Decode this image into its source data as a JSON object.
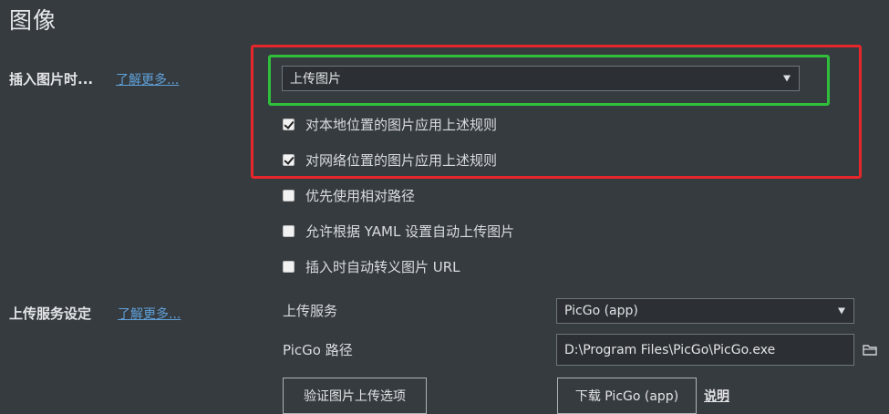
{
  "section": {
    "title": "图像"
  },
  "insert_image": {
    "label": "插入图片时...",
    "learn_more": "了解更多...",
    "action_select": {
      "value": "上传图片"
    },
    "options": [
      {
        "label": "对本地位置的图片应用上述规则",
        "checked": true
      },
      {
        "label": "对网络位置的图片应用上述规则",
        "checked": true
      },
      {
        "label": "优先使用相对路径",
        "checked": false
      },
      {
        "label": "允许根据 YAML 设置自动上传图片",
        "checked": false
      },
      {
        "label": "插入时自动转义图片 URL",
        "checked": false
      }
    ]
  },
  "upload_service": {
    "label": "上传服务设定",
    "learn_more": "了解更多...",
    "service_label": "上传服务",
    "service_select": {
      "value": "PicGo (app)"
    },
    "path_label": "PicGo 路径",
    "path_value": "D:\\Program Files\\PicGo\\PicGo.exe",
    "verify_button": "验证图片上传选项",
    "download_button": "下载 PicGo (app)",
    "help_link": "说明"
  },
  "icons": {
    "dropdown": "caret-down-icon",
    "folder": "folder-icon",
    "checkbox": "checkbox-icon"
  },
  "colors": {
    "background": "#363B40",
    "highlight_red": "#e5262a",
    "highlight_green": "#2fbf3a",
    "link": "#5fa0d8"
  }
}
